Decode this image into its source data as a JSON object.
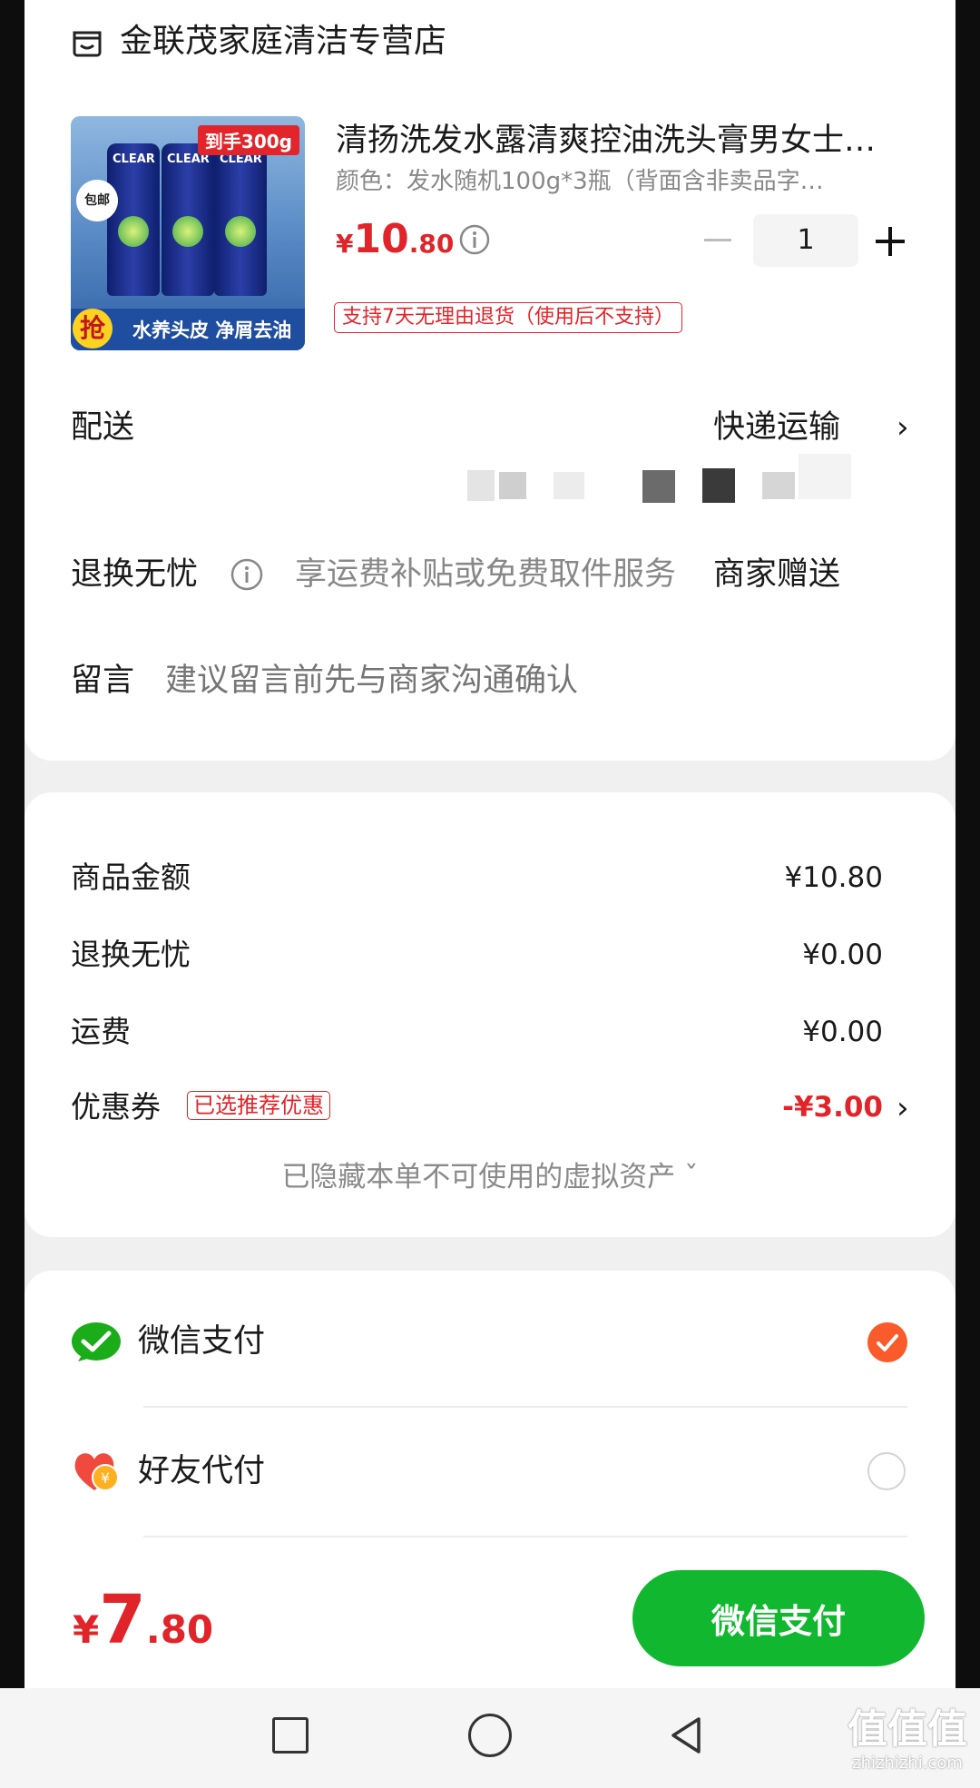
{
  "store": {
    "name": "金联茂家庭清洁专营店"
  },
  "product": {
    "title": "清扬洗发水露清爽控油洗头膏男女士…",
    "spec": "颜色：发水随机100g*3瓶（背面含非卖品字…",
    "price_currency": "¥",
    "price_int": "10",
    "price_dec": ".80",
    "quantity": "1",
    "return_policy": "支持7天无理由退货（使用后不支持）",
    "image": {
      "brand": "CLEAR",
      "tag": "到手300g",
      "badge": "包邮",
      "grab": "抢",
      "slogan": "水养头皮 净屑去油"
    }
  },
  "delivery": {
    "label": "配送",
    "value": "快递运输"
  },
  "worry_free": {
    "label": "退换无忧",
    "desc": "享运费补贴或免费取件服务",
    "value": "商家赠送"
  },
  "message": {
    "label": "留言",
    "placeholder": "建议留言前先与商家沟通确认"
  },
  "summary": {
    "goods_label": "商品金额",
    "goods_value": "¥10.80",
    "worry_label": "退换无忧",
    "worry_value": "¥0.00",
    "freight_label": "运费",
    "freight_value": "¥0.00",
    "coupon_label": "优惠券",
    "coupon_tag": "已选推荐优惠",
    "coupon_value": "-¥3.00",
    "hidden_note": "已隐藏本单不可使用的虚拟资产 ˇ"
  },
  "payment": {
    "options": [
      {
        "label": "微信支付",
        "selected": true
      },
      {
        "label": "好友代付",
        "selected": false
      }
    ]
  },
  "footer": {
    "total_currency": "¥",
    "total_int": "7",
    "total_dec": ".80",
    "pay_button": "微信支付"
  },
  "watermark": {
    "logo": "值值值",
    "url": "zhizhizhi.com"
  },
  "colors": {
    "accent_red": "#e0242a",
    "wechat_green": "#11b82f",
    "check_orange": "#fa5b2a"
  }
}
